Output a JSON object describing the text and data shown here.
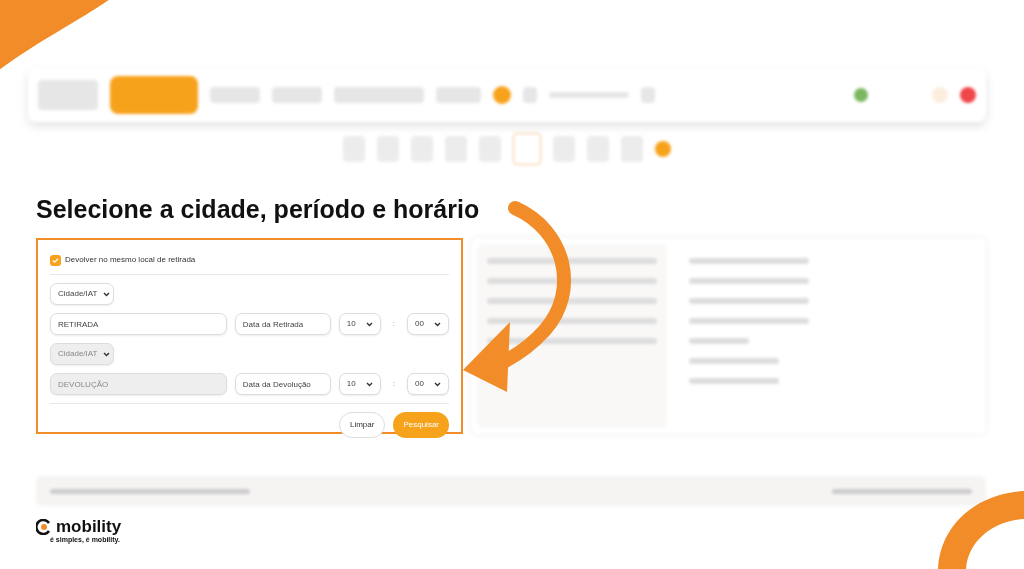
{
  "title": "Selecione a cidade, período e horário",
  "form": {
    "same_location": {
      "label": "Devolver no mesmo local de retirada",
      "checked": true
    },
    "legs": [
      {
        "type_select": "Cidade/IAT",
        "disabled": false,
        "location_placeholder": "RETIRADA",
        "date_placeholder": "Data da Retirada",
        "hour": "10",
        "separator": ":",
        "minute": "00"
      },
      {
        "type_select": "Cidade/IAT",
        "disabled": true,
        "location_placeholder": "DEVOLUÇÃO",
        "date_placeholder": "Data da Devolução",
        "hour": "10",
        "separator": ":",
        "minute": "00"
      }
    ],
    "buttons": [
      {
        "label": "Limpar",
        "kind": "outline"
      },
      {
        "label": "Pesquisar",
        "kind": "primary"
      }
    ]
  },
  "logo": {
    "name": "mobility",
    "tagline": "é simples, é mobility."
  }
}
